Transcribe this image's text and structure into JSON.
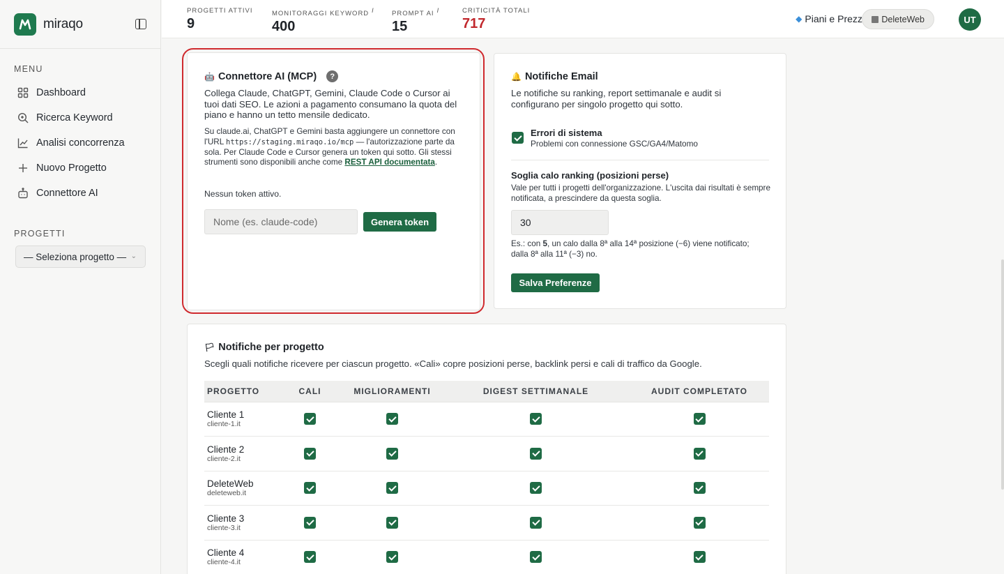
{
  "brand": {
    "name": "miraqo"
  },
  "sidebar": {
    "menu_label": "MENU",
    "items": [
      {
        "label": "Dashboard",
        "icon": "grid-icon"
      },
      {
        "label": "Ricerca Keyword",
        "icon": "search-icon"
      },
      {
        "label": "Analisi concorrenza",
        "icon": "chart-line-icon"
      },
      {
        "label": "Nuovo Progetto",
        "icon": "plus-icon"
      },
      {
        "label": "Connettore AI",
        "icon": "robot-icon"
      }
    ],
    "projects_label": "PROGETTI",
    "project_select": "— Seleziona progetto —"
  },
  "topbar": {
    "stats": [
      {
        "label": "PROGETTI ATTIVI",
        "value": "9",
        "info": ""
      },
      {
        "label": "MONITORAGGI KEYWORD",
        "value": "400",
        "info": "i"
      },
      {
        "label": "PROMPT AI",
        "value": "15",
        "info": "i"
      },
      {
        "label": "CRITICITÀ TOTALI",
        "value": "717",
        "info": ""
      }
    ],
    "plans_label": "Piani e Prezzi",
    "org_label": "DeleteWeb",
    "avatar_initials": "UT"
  },
  "mcp": {
    "title": "Connettore AI (MCP)",
    "help": "?",
    "lead": "Collega Claude, ChatGPT, Gemini, Claude Code o Cursor ai tuoi dati SEO. Le azioni a pagamento consumano la quota del piano e hanno un tetto mensile dedicato.",
    "detail_1": "Su claude.ai, ChatGPT e Gemini basta aggiungere un connettore con l'URL",
    "detail_url": "https://staging.miraqo.io/mcp",
    "detail_2": "— l'autorizzazione parte da sola. Per Claude Code e Cursor genera un token qui sotto. Gli stessi strumenti sono disponibili anche come",
    "detail_link": "REST API documentata",
    "detail_3": ".",
    "no_token": "Nessun token attivo.",
    "token_placeholder": "Nome (es. claude-code)",
    "generate_label": "Genera token"
  },
  "email": {
    "title": "Notifiche Email",
    "lead": "Le notifiche su ranking, report settimanale e audit si configurano per singolo progetto qui sotto.",
    "system_errors_title": "Errori di sistema",
    "system_errors_desc": "Problemi con connessione GSC/GA4/Matomo",
    "threshold_title": "Soglia calo ranking (posizioni perse)",
    "threshold_desc": "Vale per tutti i progetti dell'organizzazione. L'uscita dai risultati è sempre notificata, a prescindere da questa soglia.",
    "threshold_value": "30",
    "example_1": "Es.: con",
    "example_bold": "5",
    "example_2": ", un calo dalla 8ª alla 14ª posizione (−6) viene notificato; dalla 8ª alla 11ª (−3) no.",
    "save_label": "Salva Preferenze"
  },
  "per_project": {
    "title": "Notifiche per progetto",
    "lead": "Scegli quali notifiche ricevere per ciascun progetto. «Cali» copre posizioni perse, backlink persi e cali di traffico da Google.",
    "columns": [
      "PROGETTO",
      "CALI",
      "MIGLIORAMENTI",
      "DIGEST SETTIMANALE",
      "AUDIT COMPLETATO"
    ],
    "rows": [
      {
        "name": "Cliente 1",
        "domain": "cliente-1.it"
      },
      {
        "name": "Cliente 2",
        "domain": "cliente-2.it"
      },
      {
        "name": "DeleteWeb",
        "domain": "deleteweb.it"
      },
      {
        "name": "Cliente 3",
        "domain": "cliente-3.it"
      },
      {
        "name": "Cliente 4",
        "domain": "cliente-4.it"
      }
    ]
  }
}
